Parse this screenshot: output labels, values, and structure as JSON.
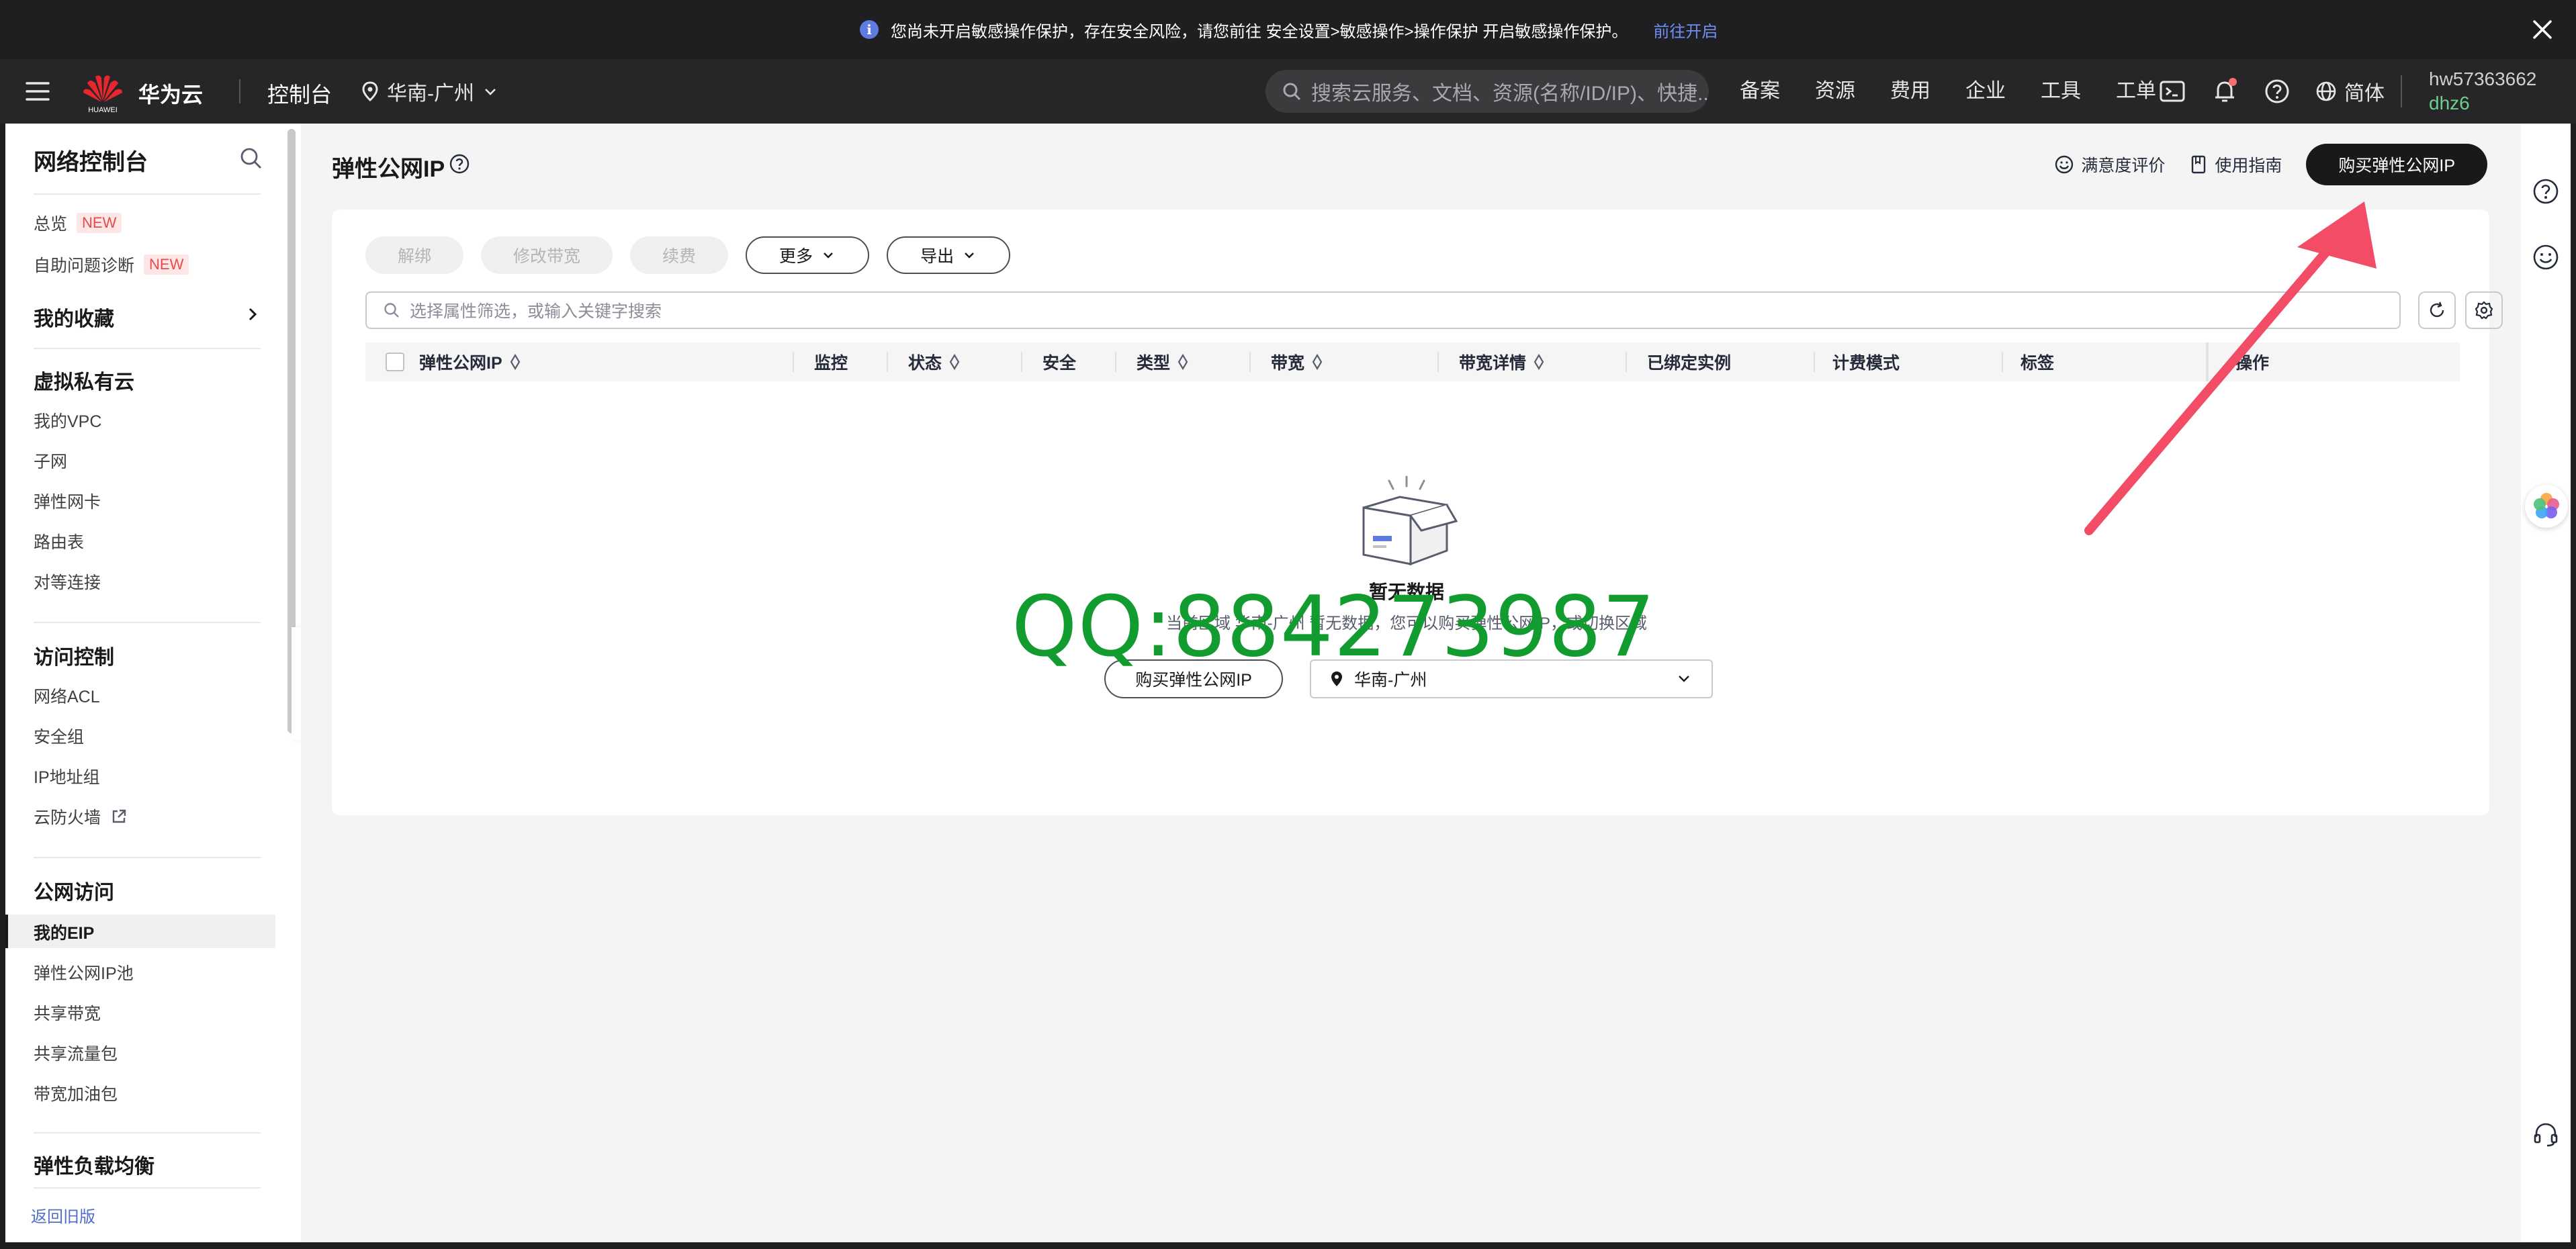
{
  "banner": {
    "text": "您尚未开启敏感操作保护，存在安全风险，请您前往 安全设置>敏感操作>操作保护 开启敏感操作保护。",
    "link": "前往开启"
  },
  "header": {
    "logo_sub": "HUAWEI",
    "brand": "华为云",
    "console": "控制台",
    "region": "华南-广州",
    "search_placeholder": "搜索云服务、文档、资源(名称/ID/IP)、快捷...",
    "nav": [
      "备案",
      "资源",
      "费用",
      "企业",
      "工具",
      "工单"
    ],
    "lang": "简体",
    "user": "hw57363662",
    "user_sub": "dhz6"
  },
  "sidebar": {
    "title": "网络控制台",
    "overview": "总览",
    "diagnose": "自助问题诊断",
    "badge_new": "NEW",
    "favorites": "我的收藏",
    "vpc_group": "虚拟私有云",
    "vpc_items": [
      "我的VPC",
      "子网",
      "弹性网卡",
      "路由表",
      "对等连接"
    ],
    "acl_group": "访问控制",
    "acl_items": [
      "网络ACL",
      "安全组",
      "IP地址组",
      "云防火墙"
    ],
    "public_group": "公网访问",
    "public_items": [
      "我的EIP",
      "弹性公网IP池",
      "共享带宽",
      "共享流量包",
      "带宽加油包"
    ],
    "elb_group": "弹性负载均衡",
    "back_old": "返回旧版"
  },
  "main": {
    "title": "弹性公网IP",
    "satisfaction": "满意度评价",
    "guide": "使用指南",
    "buy": "购买弹性公网IP",
    "toolbar": [
      "解绑",
      "修改带宽",
      "续费",
      "更多",
      "导出"
    ],
    "filter_placeholder": "选择属性筛选，或输入关键字搜索",
    "columns": [
      "弹性公网IP",
      "监控",
      "状态",
      "安全",
      "类型",
      "带宽",
      "带宽详情",
      "已绑定实例",
      "计费模式",
      "标签",
      "操作"
    ],
    "empty_title": "暂无数据",
    "empty_desc": "当前区域 华南-广州 暂无数据，您可以购买弹性公网IP，或切换区域",
    "empty_buy": "购买弹性公网IP",
    "empty_region": "华南-广州"
  },
  "watermark": "QQ:884273987",
  "colors": {
    "accent_dark": "#191919",
    "link_blue": "#526ecc",
    "new_badge": "#e84a4a",
    "watermark_green": "#129c30",
    "annotation_arrow": "#f24c66"
  }
}
